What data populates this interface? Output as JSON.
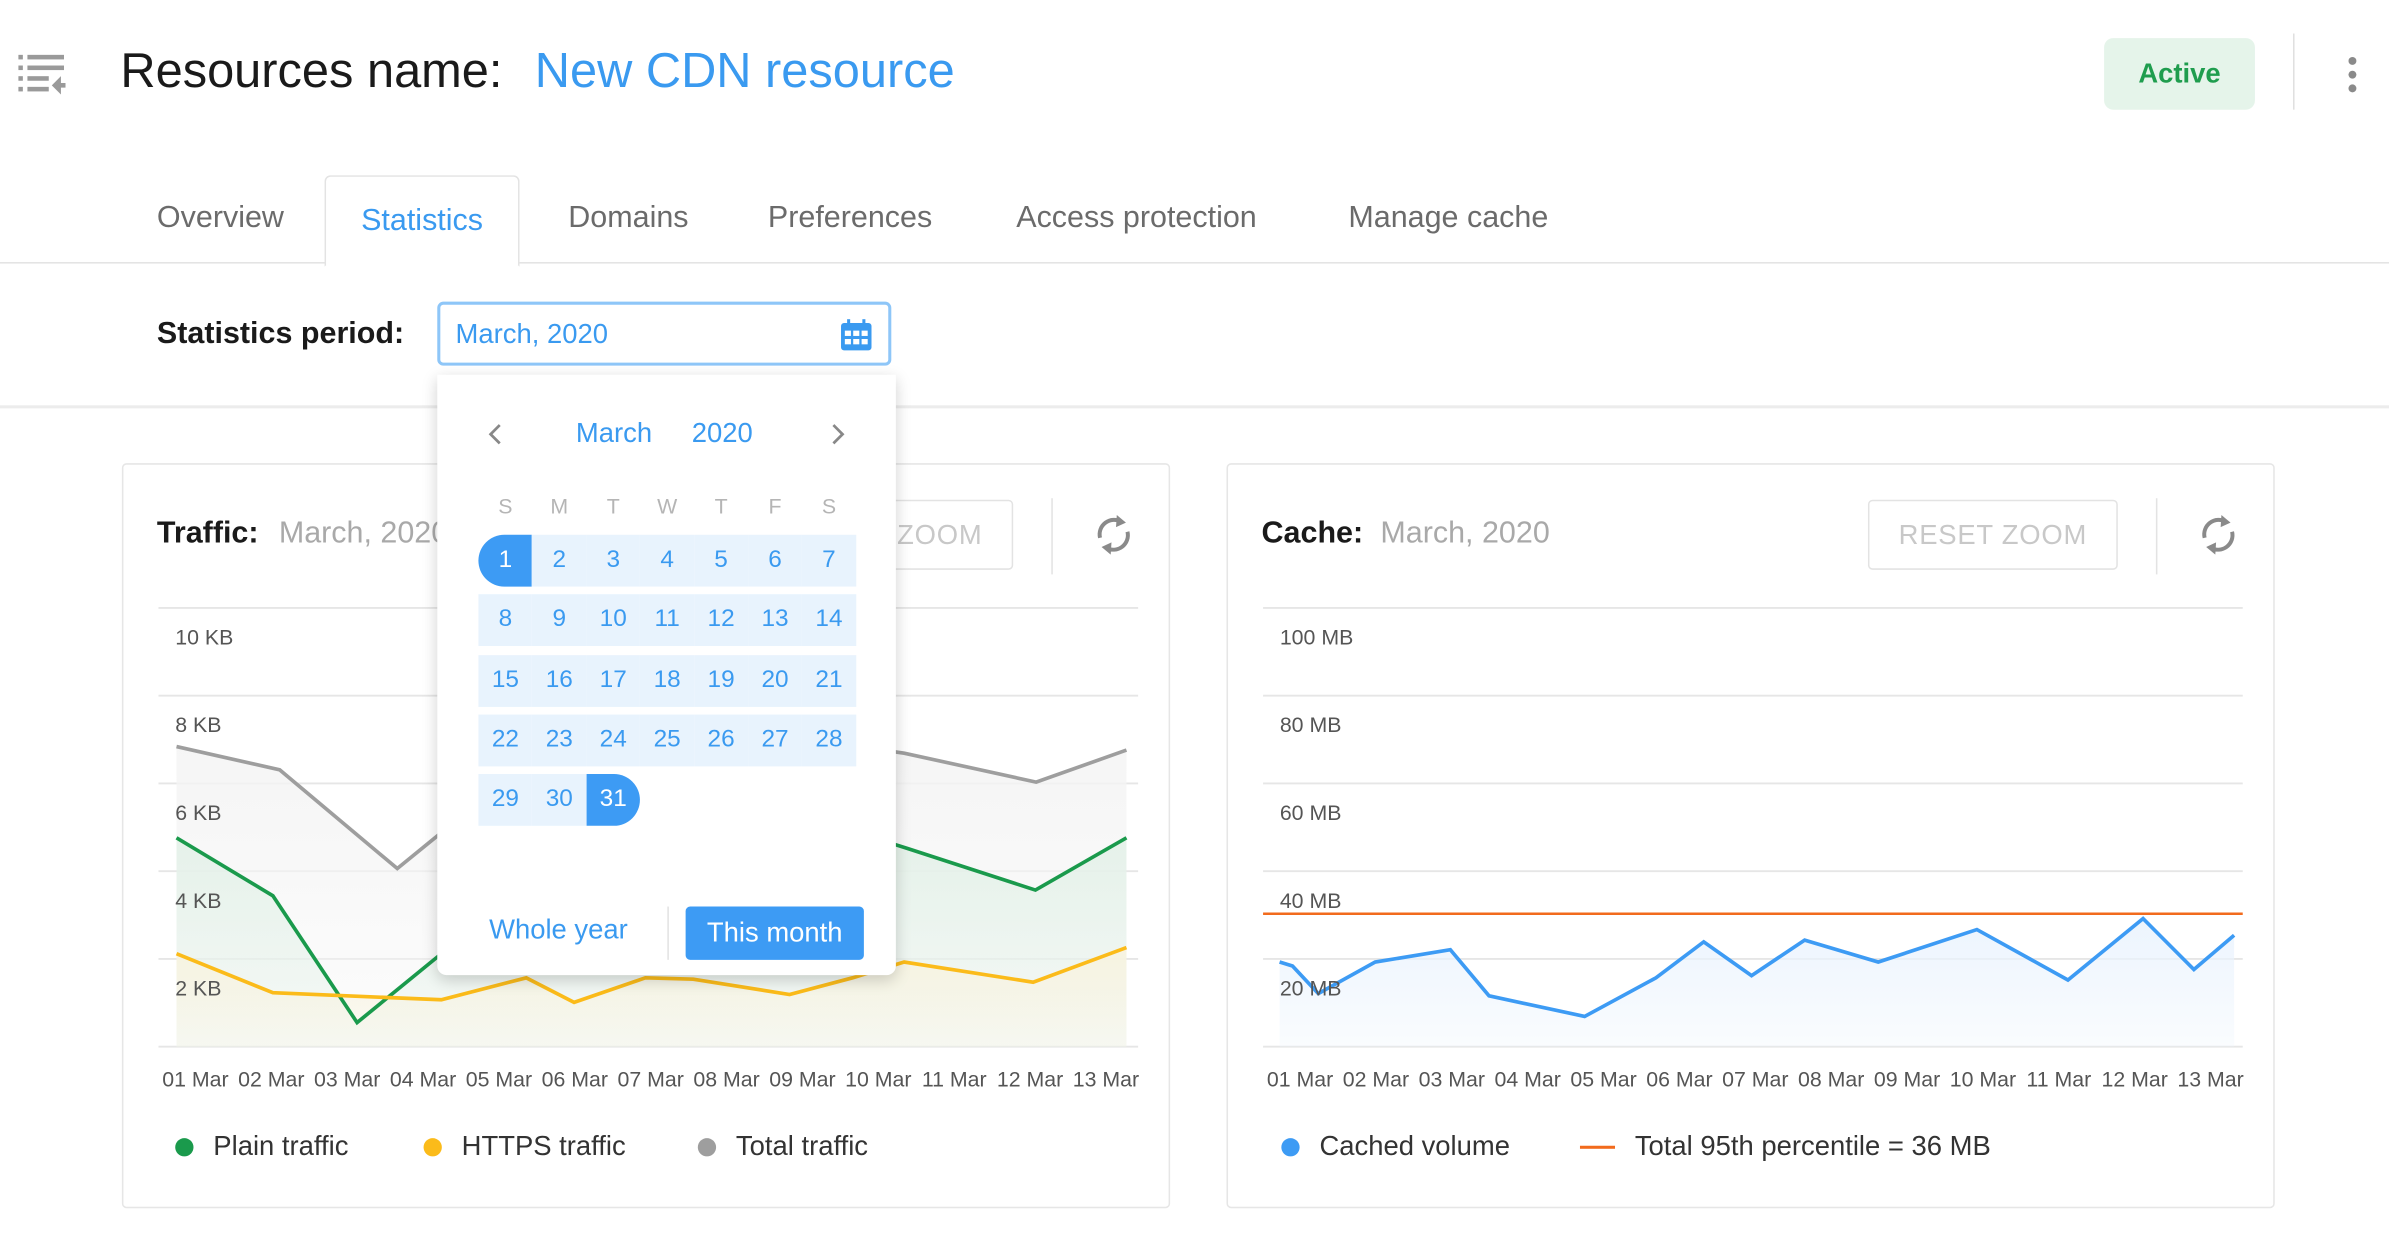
{
  "header": {
    "title_label": "Resources name:",
    "resource_name": "New CDN resource",
    "status": "Active",
    "status_color": "#1f9d4e",
    "icons": {
      "menu": "menu-collapse-icon",
      "more": "kebab-menu-icon"
    }
  },
  "tabs": [
    {
      "label": "Overview",
      "active": false
    },
    {
      "label": "Statistics",
      "active": true
    },
    {
      "label": "Domains",
      "active": false
    },
    {
      "label": "Preferences",
      "active": false
    },
    {
      "label": "Access protection",
      "active": false
    },
    {
      "label": "Manage cache",
      "active": false
    }
  ],
  "period": {
    "label": "Statistics period:",
    "value": "March, 2020",
    "icon": "calendar-icon"
  },
  "calendar": {
    "month": "March",
    "year": "2020",
    "weekdays": [
      "S",
      "M",
      "T",
      "W",
      "T",
      "F",
      "S"
    ],
    "days_in_month": 31,
    "first_weekday_index": 0,
    "selected_start": 1,
    "selected_end": 31,
    "whole_year_label": "Whole year",
    "this_month_label": "This month"
  },
  "cards": {
    "traffic": {
      "title": "Traffic:",
      "period": "March, 2020",
      "reset_zoom": "RESET ZOOM",
      "refresh_icon": "refresh-icon"
    },
    "cache": {
      "title": "Cache:",
      "period": "March, 2020",
      "reset_zoom": "RESET ZOOM",
      "refresh_icon": "refresh-icon"
    }
  },
  "chart_data": [
    {
      "type": "area",
      "x_unit": "day of March",
      "x_tick_labels": [
        "01 Mar",
        "02 Mar",
        "03 Mar",
        "04 Mar",
        "05 Mar",
        "06 Mar",
        "07 Mar",
        "08 Mar",
        "09 Mar",
        "10 Mar",
        "11 Mar",
        "12 Mar",
        "13 Mar"
      ],
      "y_tick_labels": [
        "10 KB",
        "8 KB",
        "6 KB",
        "4 KB",
        "2 KB"
      ],
      "y_ticks": [
        10,
        8,
        6,
        4,
        2
      ],
      "ylim": [
        0,
        10
      ],
      "grid": true,
      "legend": "bottom-left",
      "series": [
        {
          "name": "Plain traffic",
          "color": "#1a9a4c",
          "fill": "#e3f1e8",
          "x": [
            0.75,
            2.02,
            3.13,
            4.22,
            6.0,
            8.0,
            9.5,
            10.38,
            12.07,
            13.27
          ],
          "y": [
            4.76,
            3.44,
            0.55,
            2.09,
            3.0,
            4.4,
            5.0,
            4.52,
            3.57,
            4.76
          ]
        },
        {
          "name": "HTTPS traffic",
          "color": "#fbbb1a",
          "fill": "#f8f3df",
          "x": [
            0.75,
            2.02,
            4.24,
            5.36,
            5.99,
            6.93,
            7.56,
            8.83,
            9.66,
            10.34,
            12.04,
            13.27
          ],
          "y": [
            2.12,
            1.23,
            1.07,
            1.57,
            1.01,
            1.57,
            1.54,
            1.19,
            1.57,
            1.93,
            1.47,
            2.26
          ]
        },
        {
          "name": "Total traffic",
          "color": "#9e9e9e",
          "fill": "#f4f4f4",
          "x": [
            0.75,
            2.11,
            3.66,
            4.22,
            6.0,
            8.0,
            9.5,
            10.34,
            12.08,
            13.27
          ],
          "y": [
            6.84,
            6.31,
            4.06,
            4.85,
            6.0,
            7.0,
            6.9,
            6.69,
            6.03,
            6.76
          ]
        }
      ]
    },
    {
      "type": "area",
      "x_unit": "day of March",
      "x_tick_labels": [
        "01 Mar",
        "02 Mar",
        "03 Mar",
        "04 Mar",
        "05 Mar",
        "06 Mar",
        "07 Mar",
        "08 Mar",
        "09 Mar",
        "10 Mar",
        "11 Mar",
        "12 Mar",
        "13 Mar"
      ],
      "y_tick_labels": [
        "100 MB",
        "80 MB",
        "60 MB",
        "40 MB",
        "20 MB"
      ],
      "y_ticks": [
        100,
        80,
        60,
        40,
        20
      ],
      "ylim": [
        0,
        100
      ],
      "grid": true,
      "legend": "bottom-left",
      "series": [
        {
          "name": "Cached volume",
          "color": "#3d9bf4",
          "fill": "#eaf3fd",
          "x": [
            0.73,
            0.9,
            1.24,
            1.99,
            2.98,
            3.49,
            4.75,
            5.69,
            6.32,
            6.95,
            7.65,
            8.62,
            9.92,
            11.12,
            12.11,
            12.78,
            13.31
          ],
          "y": [
            19.3,
            18.4,
            12.1,
            19.3,
            22.1,
            11.6,
            6.9,
            15.7,
            23.9,
            16.2,
            24.3,
            19.3,
            26.7,
            15.2,
            29.2,
            17.6,
            25.4
          ]
        }
      ],
      "reference_line": {
        "name": "Total 95th percentile = 36 MB",
        "color": "#f26b1d",
        "y": 30.3
      }
    }
  ]
}
